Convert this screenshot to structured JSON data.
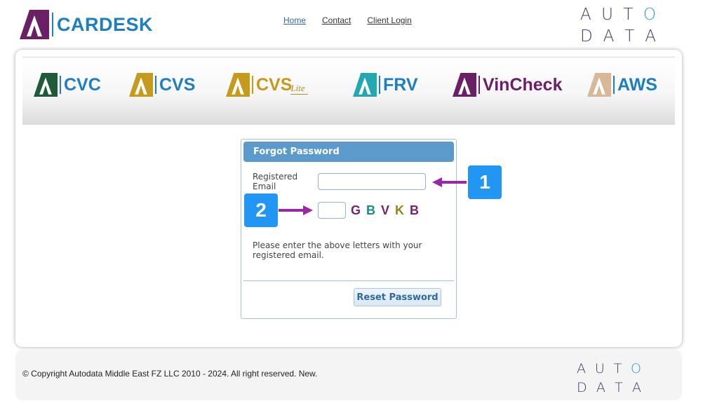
{
  "brand": {
    "name": "CARDESK"
  },
  "nav": {
    "items": [
      {
        "label": "Home"
      },
      {
        "label": "Contact"
      },
      {
        "label": "Client Login"
      }
    ]
  },
  "autodata_logo": {
    "line1": [
      "A",
      "U",
      "T",
      "O"
    ],
    "line2": [
      "D",
      "A",
      "T",
      "A"
    ]
  },
  "products": [
    {
      "name": "CVC",
      "color": "#1f5b3a"
    },
    {
      "name": "CVS",
      "color": "#c69a1c"
    },
    {
      "name": "CVS",
      "suffix": "Lite",
      "color": "#c69a1c"
    },
    {
      "name": "FRV",
      "color": "#23a7b0"
    },
    {
      "name": "VinCheck",
      "color": "#6b1f66"
    },
    {
      "name": "AWS",
      "color": "#1d7fc0"
    }
  ],
  "forgot": {
    "title": "Forgot Password",
    "email_label": "Registered Email",
    "email_value": "",
    "captcha_value": "",
    "captcha_letters": [
      {
        "char": "G",
        "color": "#7b1f6e"
      },
      {
        "char": "B",
        "color": "#1c8a8a"
      },
      {
        "char": "V",
        "color": "#7b1f6e"
      },
      {
        "char": "K",
        "color": "#8a8a1c"
      },
      {
        "char": "B",
        "color": "#7b1f6e"
      }
    ],
    "hint": "Please enter the above letters with your registered email.",
    "reset_label": "Reset Password"
  },
  "callouts": [
    {
      "label": "1"
    },
    {
      "label": "2"
    }
  ],
  "colors": {
    "accent": "#2196f3",
    "arrow": "#9a27a8",
    "panel_header": "#5b9acb"
  },
  "footer": {
    "copyright": "© Copyright Autodata Middle East FZ LLC 2010 - 2024. All right reserved. New."
  }
}
